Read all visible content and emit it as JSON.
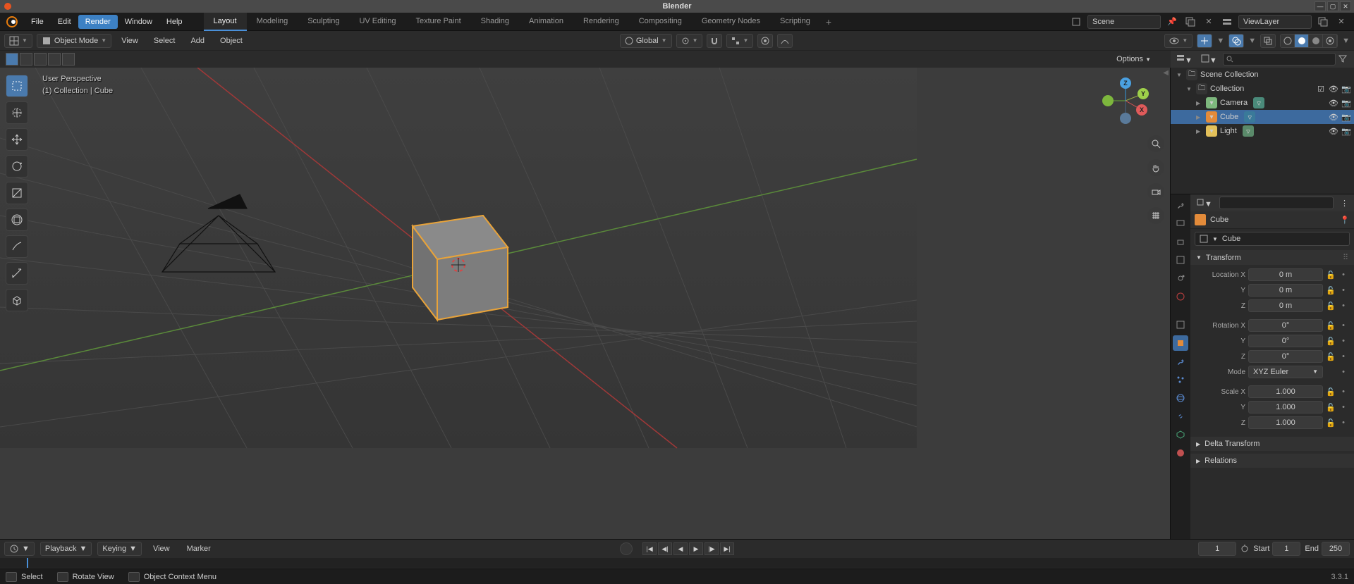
{
  "titlebar": {
    "title": "Blender"
  },
  "menu": {
    "items": [
      "File",
      "Edit",
      "Render",
      "Window",
      "Help"
    ],
    "active_index": 2
  },
  "workspaces": {
    "tabs": [
      "Layout",
      "Modeling",
      "Sculpting",
      "UV Editing",
      "Texture Paint",
      "Shading",
      "Animation",
      "Rendering",
      "Compositing",
      "Geometry Nodes",
      "Scripting"
    ],
    "active_index": 0
  },
  "scene": {
    "name": "Scene"
  },
  "viewlayer": {
    "name": "ViewLayer"
  },
  "header": {
    "mode": "Object Mode",
    "view": "View",
    "select": "Select",
    "add": "Add",
    "object": "Object",
    "orientation": "Global",
    "options": "Options"
  },
  "viewport": {
    "label_line1": "User Perspective",
    "label_line2": "(1) Collection | Cube"
  },
  "outliner": {
    "root": "Scene Collection",
    "collection": "Collection",
    "items": [
      {
        "name": "Camera",
        "icon_color": "#7db77d",
        "tag_bg": "#4a8a7a"
      },
      {
        "name": "Cube",
        "icon_color": "#e38b3a",
        "tag_bg": "#3a7a9a",
        "selected": true
      },
      {
        "name": "Light",
        "icon_color": "#e3c05a",
        "tag_bg": "#5a8a6a"
      }
    ]
  },
  "properties": {
    "object_name": "Cube",
    "data_name": "Cube",
    "sections": {
      "transform": {
        "title": "Transform",
        "location": {
          "label": "Location X",
          "x": "0 m",
          "y": "0 m",
          "z": "0 m",
          "yl": "Y",
          "zl": "Z"
        },
        "rotation": {
          "label": "Rotation X",
          "x": "0°",
          "y": "0°",
          "z": "0°",
          "yl": "Y",
          "zl": "Z"
        },
        "mode": {
          "label": "Mode",
          "value": "XYZ Euler"
        },
        "scale": {
          "label": "Scale X",
          "x": "1.000",
          "y": "1.000",
          "z": "1.000",
          "yl": "Y",
          "zl": "Z"
        }
      },
      "delta": {
        "title": "Delta Transform"
      },
      "relations": {
        "title": "Relations"
      }
    }
  },
  "timeline": {
    "playback": "Playback",
    "keying": "Keying",
    "view": "View",
    "marker": "Marker",
    "current": "1",
    "start_label": "Start",
    "start": "1",
    "end_label": "End",
    "end": "250"
  },
  "status": {
    "hint1": "Select",
    "hint2": "Rotate View",
    "hint3": "Object Context Menu",
    "version": "3.3.1"
  }
}
